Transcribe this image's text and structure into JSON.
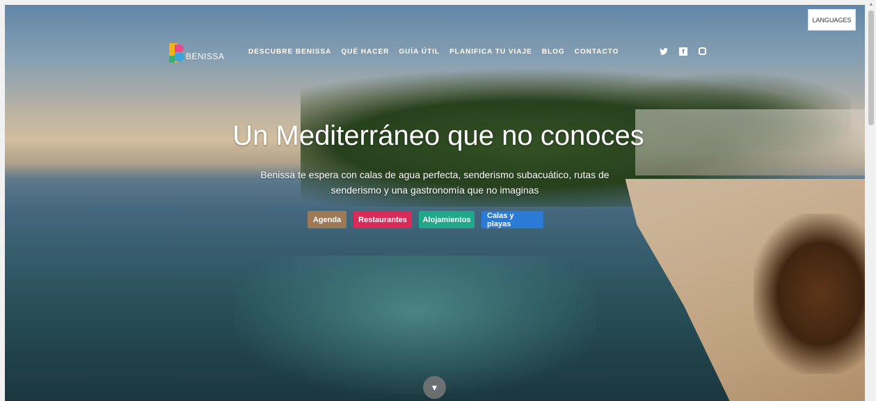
{
  "header": {
    "logo_text": "BENISSA",
    "nav": [
      {
        "label": "DESCUBRE BENISSA"
      },
      {
        "label": "QUÉ HACER"
      },
      {
        "label": "GUÍA ÚTIL"
      },
      {
        "label": "PLANIFICA TU VIAJE"
      },
      {
        "label": "BLOG"
      },
      {
        "label": "CONTACTO"
      }
    ],
    "social": [
      {
        "icon": "twitter-icon",
        "glyph": "🐦"
      },
      {
        "icon": "facebook-icon",
        "glyph": "f"
      },
      {
        "icon": "instagram-icon",
        "glyph": ""
      }
    ],
    "languages_label": "LANGUAGES"
  },
  "hero": {
    "title": "Un Mediterráneo que no conoces",
    "subtitle": "Benissa te espera con calas de agua perfecta, senderismo subacuático, rutas de senderismo y una gastronomía que no imaginas",
    "buttons": [
      {
        "label": "Agenda",
        "color": "#9b7a55"
      },
      {
        "label": "Restaurantes",
        "color": "#d92b5a"
      },
      {
        "label": "Alojamientos",
        "color": "#1fa88a"
      },
      {
        "label": "Calas y playas",
        "color": "#2b7bd6"
      }
    ],
    "scroll_icon": "chevron-down-icon"
  }
}
